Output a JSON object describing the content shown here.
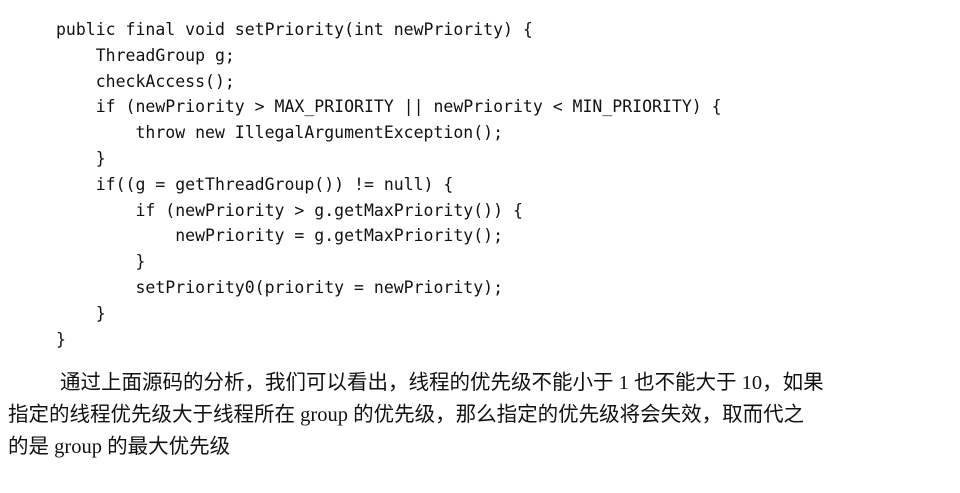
{
  "code": {
    "lines": [
      "public final void setPriority(int newPriority) {",
      "    ThreadGroup g;",
      "    checkAccess();",
      "    if (newPriority > MAX_PRIORITY || newPriority < MIN_PRIORITY) {",
      "        throw new IllegalArgumentException();",
      "    }",
      "    if((g = getThreadGroup()) != null) {",
      "        if (newPriority > g.getMaxPriority()) {",
      "            newPriority = g.getMaxPriority();",
      "        }",
      "        setPriority0(priority = newPriority);",
      "    }",
      "}"
    ]
  },
  "paragraph": {
    "lines": [
      "通过上面源码的分析，我们可以看出，线程的优先级不能小于 1 也不能大于 10，如果",
      "指定的线程优先级大于线程所在 group 的优先级，那么指定的优先级将会失效，取而代之",
      "的是 group 的最大优先级"
    ]
  }
}
